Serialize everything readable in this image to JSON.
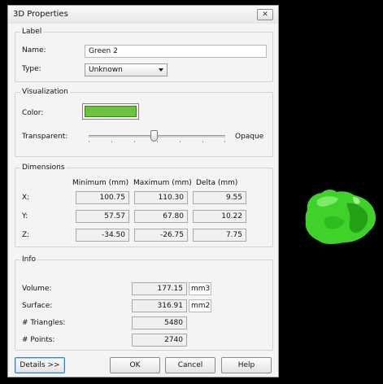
{
  "dialog": {
    "title": "3D Properties",
    "close_glyph": "✕"
  },
  "label_group": {
    "title": "Label",
    "name_label": "Name:",
    "name_value": "Green 2",
    "type_label": "Type:",
    "type_value": "Unknown"
  },
  "visualization_group": {
    "title": "Visualization",
    "color_label": "Color:",
    "color_value": "#6bc43d",
    "transparent_label": "Transparent:",
    "opaque_label": "Opaque",
    "opacity_level": 0.48
  },
  "dimensions_group": {
    "title": "Dimensions",
    "headers": [
      "Minimum (mm)",
      "Maximum (mm)",
      "Delta (mm)"
    ],
    "rows": [
      {
        "axis": "X:",
        "min": "100.75",
        "max": "110.30",
        "delta": "9.55"
      },
      {
        "axis": "Y:",
        "min": "57.57",
        "max": "67.80",
        "delta": "10.22"
      },
      {
        "axis": "Z:",
        "min": "-34.50",
        "max": "-26.75",
        "delta": "7.75"
      }
    ]
  },
  "info_group": {
    "title": "Info",
    "volume_label": "Volume:",
    "volume_value": "177.15",
    "volume_unit": "mm3",
    "surface_label": "Surface:",
    "surface_value": "316.91",
    "surface_unit": "mm2",
    "triangles_label": "# Triangles:",
    "triangles_value": "5480",
    "points_label": "# Points:",
    "points_value": "2740"
  },
  "buttons": {
    "details": "Details >>",
    "ok": "OK",
    "cancel": "Cancel",
    "help": "Help"
  },
  "viewport": {
    "background": "#000000",
    "object_color": "#3fd22a"
  }
}
